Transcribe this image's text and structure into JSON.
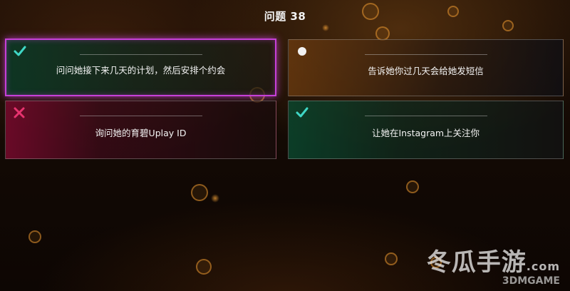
{
  "header": {
    "title": "问题 38"
  },
  "answers": [
    {
      "label": "问问她接下来几天的计划，然后安排个约会",
      "mark": "check-icon",
      "selected": true
    },
    {
      "label": "告诉她你过几天会给她发短信",
      "mark": "dot-icon",
      "selected": false
    },
    {
      "label": "询问她的育碧Uplay ID",
      "mark": "cross-icon",
      "selected": false
    },
    {
      "label": "让她在Instagram上关注你",
      "mark": "check-icon",
      "selected": false
    }
  ],
  "colors": {
    "check": "#3fd7c6",
    "cross": "#e8336f",
    "selected_border": "#c640d8"
  },
  "watermark": {
    "brand": "冬瓜手游",
    "domain": ".com",
    "sub": "3DMGAME"
  }
}
